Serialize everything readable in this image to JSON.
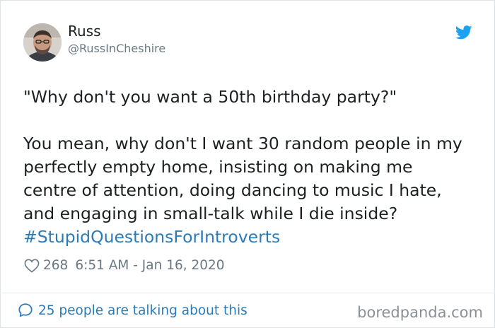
{
  "user": {
    "name": "Russ",
    "handle": "@RussInCheshire",
    "avatar_icon": "profile-photo"
  },
  "tweet": {
    "line1": "\"Why don't you want a 50th birthday party?\"",
    "line2": "You mean, why don't I want 30 random people in my",
    "line3": "perfectly empty home, insisting on making me",
    "line4": "centre of attention, doing dancing to music I hate,",
    "line5": "and engaging in small-talk while I die inside?",
    "hashtag": "#StupidQuestionsForIntroverts"
  },
  "meta": {
    "like_count": "268",
    "timestamp": "6:51 AM - Jan 16, 2020"
  },
  "footer": {
    "talking_label": "25 people are talking about this",
    "watermark": "boredpanda.com"
  },
  "colors": {
    "twitter_blue": "#1da1f2",
    "link_blue": "#2b7bb9",
    "text": "#1c2022",
    "muted": "#697882"
  }
}
